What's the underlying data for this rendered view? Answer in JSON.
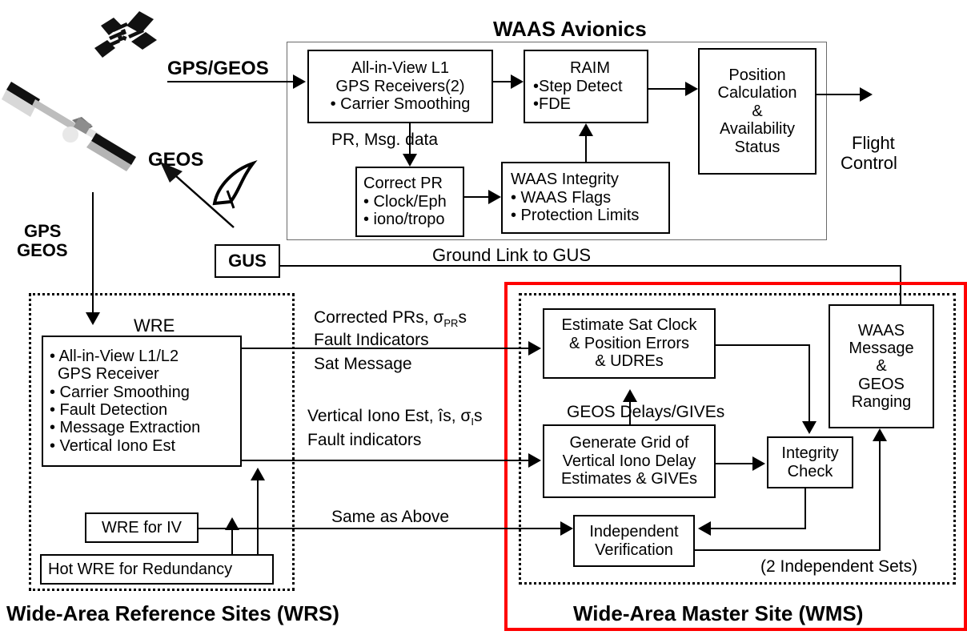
{
  "diagram": {
    "title_avionics": "WAAS Avionics",
    "title_wrs": "Wide-Area Reference Sites (WRS)",
    "title_wms": "Wide-Area Master Site (WMS)"
  },
  "space": {
    "gps_geos_link": "GPS/GEOS",
    "geos_label": "GEOS",
    "gps_geos_down_line1": "GPS",
    "gps_geos_down_line2": "GEOS",
    "gus_label": "GUS",
    "ground_link": "Ground Link to GUS"
  },
  "avionics": {
    "receivers": {
      "l1": "All-in-View L1",
      "l2": "GPS Receivers(2)",
      "l3": "• Carrier Smoothing"
    },
    "pr_msg_label": "PR, Msg. data",
    "raim": {
      "l1": "RAIM",
      "l2": "•Step Detect",
      "l3": "•FDE"
    },
    "position": {
      "l1": "Position",
      "l2": "Calculation",
      "l3": "&",
      "l4": "Availability",
      "l5": "Status"
    },
    "flight_control_line1": "Flight",
    "flight_control_line2": "Control",
    "correct_pr": {
      "l1": "Correct PR",
      "l2": "• Clock/Eph",
      "l3": "• iono/tropo"
    },
    "integrity": {
      "l1": "WAAS Integrity",
      "l2": "• WAAS Flags",
      "l3": "• Protection Limits"
    }
  },
  "wrs": {
    "wre_title": "WRE",
    "wre_items": [
      "• All-in-View L1/L2",
      "  GPS Receiver",
      "• Carrier  Smoothing",
      "• Fault Detection",
      "• Message Extraction",
      "• Vertical Iono Est"
    ],
    "wre_for_iv": "WRE for IV",
    "hot_wre": "Hot WRE for Redundancy"
  },
  "links": {
    "corrected_prs_pre": "Corrected PRs, ",
    "corrected_prs_sigma": "σ",
    "corrected_prs_sub": "PR",
    "corrected_prs_post": "s",
    "fault_indicators_cap": "Fault Indicators",
    "sat_message": "Sat Message",
    "vertical_iono_pre": "Vertical Iono Est, îs, ",
    "vertical_iono_sigma": "σ",
    "vertical_iono_sub": "I",
    "vertical_iono_post": "s",
    "fault_indicators_low": "Fault indicators",
    "same_as_above": "Same as Above"
  },
  "wms": {
    "estimate_sat": {
      "l1": "Estimate Sat Clock",
      "l2": "& Position Errors",
      "l3": "& UDREs"
    },
    "geos_delays": "GEOS Delays/GIVEs",
    "generate_grid": {
      "l1": "Generate Grid of",
      "l2": "Vertical Iono Delay",
      "l3": "Estimates & GIVEs"
    },
    "integrity_check": {
      "l1": "Integrity",
      "l2": "Check"
    },
    "independent_verification": {
      "l1": "Independent",
      "l2": "Verification"
    },
    "waas_message": {
      "l1": "WAAS",
      "l2": "Message",
      "l3": "&",
      "l4": "GEOS",
      "l5": "Ranging"
    },
    "independent_sets": "(2 Independent Sets)"
  },
  "icons": {
    "gps_satellite": "gps-satellite-icon",
    "geos_satellite": "geos-satellite-icon",
    "antenna_dish": "antenna-dish-icon"
  },
  "colors": {
    "wms_highlight": "#ff0000",
    "line": "#000000",
    "background": "#ffffff"
  }
}
